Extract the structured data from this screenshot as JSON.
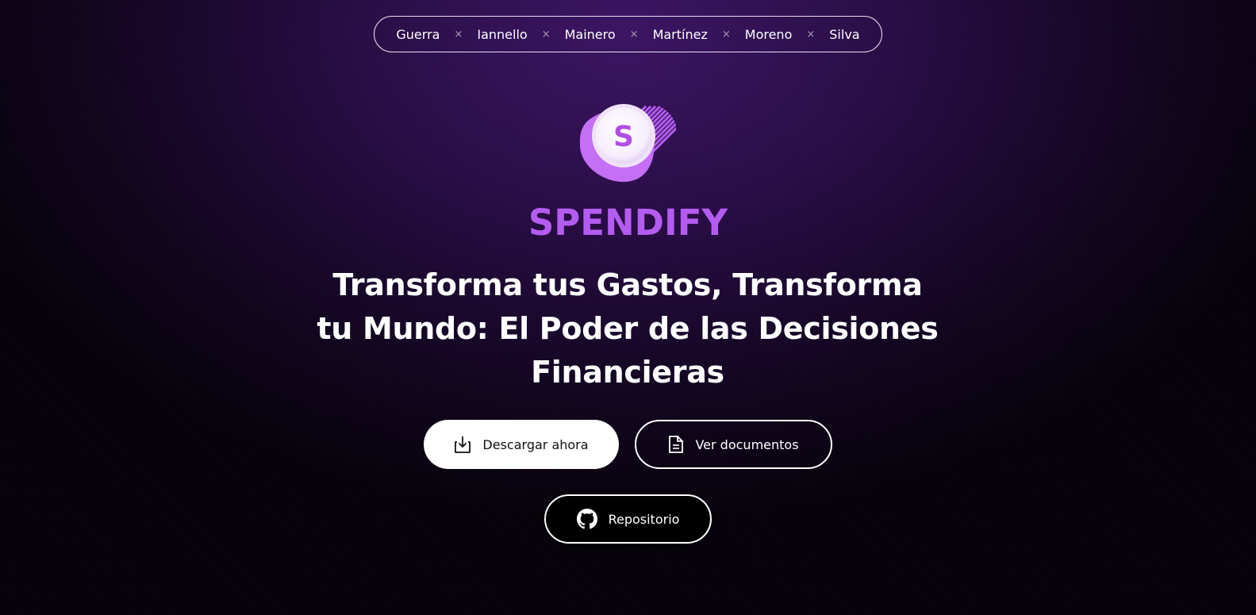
{
  "authors": [
    "Guerra",
    "Iannello",
    "Mainero",
    "Martínez",
    "Moreno",
    "Silva"
  ],
  "separator": "×",
  "logo": {
    "letter": "S",
    "icon": "spendify-coin-logo-icon"
  },
  "brand": {
    "name": "SPENDIFY",
    "color": "#b45cf0"
  },
  "headline": "Transforma tus Gastos, Transforma tu Mundo: El Poder de las Decisiones Financieras",
  "buttons": {
    "download": {
      "label": "Descargar ahora",
      "icon": "download-icon"
    },
    "docs": {
      "label": "Ver documentos",
      "icon": "document-icon"
    },
    "repo": {
      "label": "Repositorio",
      "icon": "github-icon"
    }
  },
  "colors": {
    "background_top": "#3c1464",
    "background_bottom": "#050108",
    "accent": "#b45cf0"
  }
}
